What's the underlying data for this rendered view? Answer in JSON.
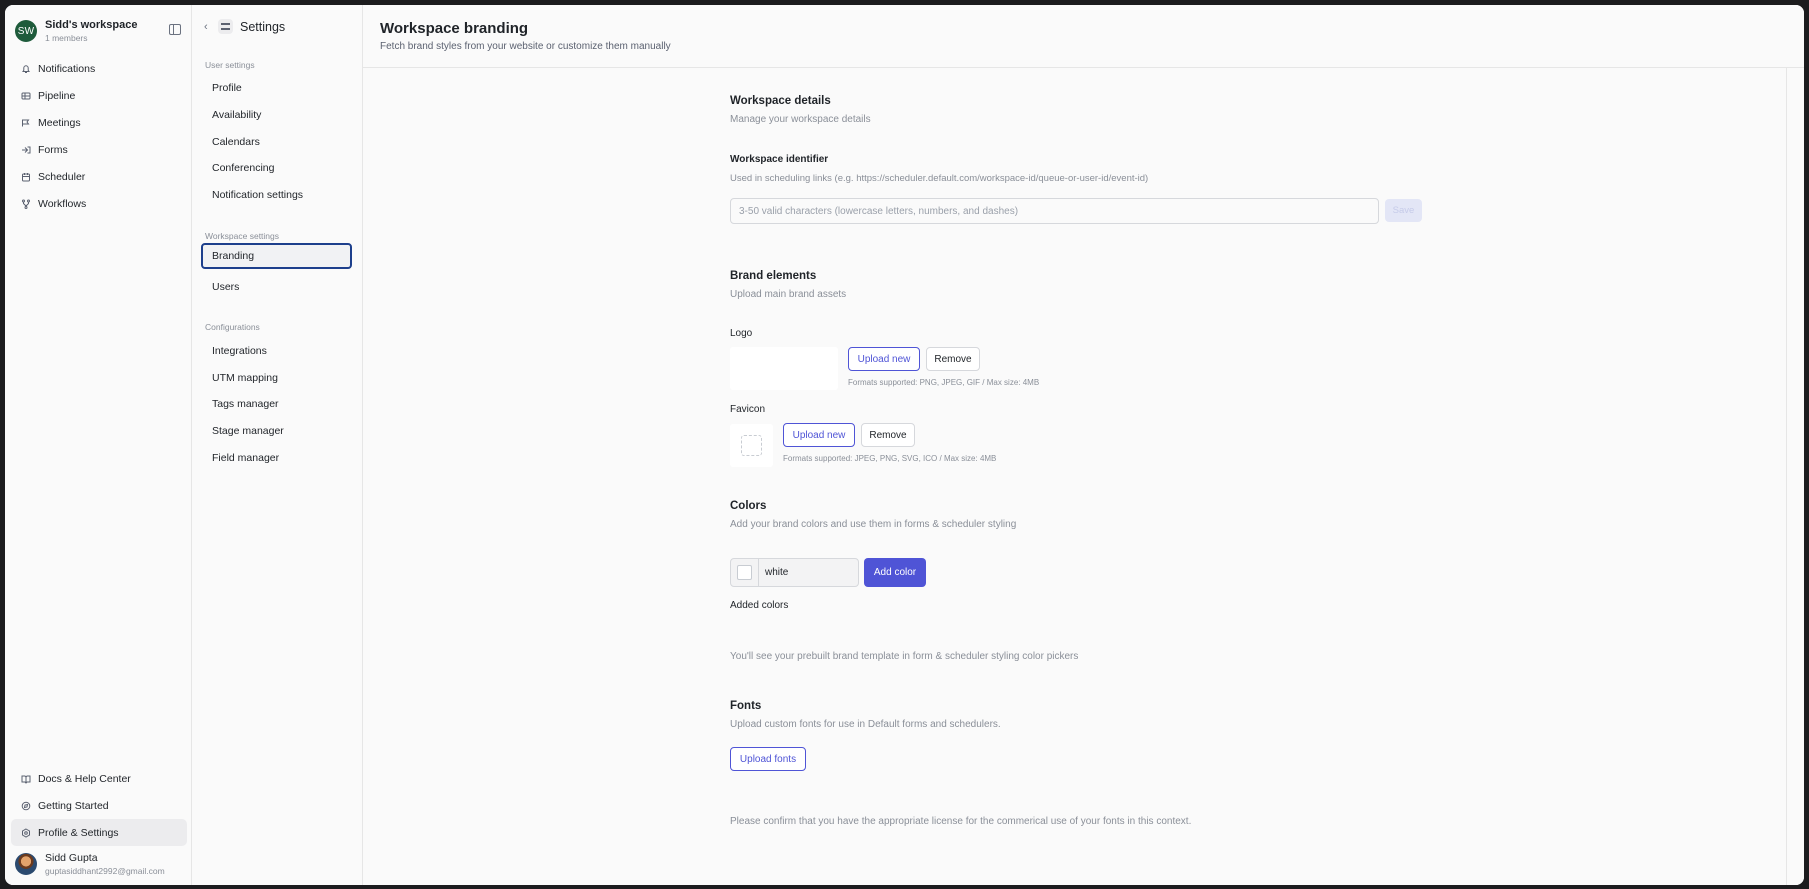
{
  "workspace": {
    "initials": "SW",
    "name": "Sidd's workspace",
    "members": "1 members"
  },
  "nav": {
    "items": [
      {
        "label": "Notifications",
        "icon": "bell-icon"
      },
      {
        "label": "Pipeline",
        "icon": "pipeline-icon"
      },
      {
        "label": "Meetings",
        "icon": "meetings-icon"
      },
      {
        "label": "Forms",
        "icon": "forms-icon"
      },
      {
        "label": "Scheduler",
        "icon": "calendar-icon"
      },
      {
        "label": "Workflows",
        "icon": "workflow-icon"
      }
    ],
    "bottom": [
      {
        "label": "Docs & Help Center",
        "icon": "book-icon"
      },
      {
        "label": "Getting Started",
        "icon": "rocket-icon"
      },
      {
        "label": "Profile & Settings",
        "icon": "hexagon-icon"
      }
    ]
  },
  "user": {
    "name": "Sidd Gupta",
    "email": "guptasiddhant2992@gmail.com"
  },
  "settings_nav": {
    "title": "Settings",
    "user_label": "User settings",
    "user_items": [
      "Profile",
      "Availability",
      "Calendars",
      "Conferencing",
      "Notification settings"
    ],
    "workspace_label": "Workspace settings",
    "workspace_items": [
      "Branding",
      "Users"
    ],
    "config_label": "Configurations",
    "config_items": [
      "Integrations",
      "UTM mapping",
      "Tags manager",
      "Stage manager",
      "Field manager"
    ]
  },
  "page": {
    "title": "Workspace branding",
    "subtitle": "Fetch brand styles from your website or customize them manually"
  },
  "details": {
    "title": "Workspace details",
    "subtitle": "Manage your workspace details",
    "identifier_label": "Workspace identifier",
    "identifier_hint": "Used in scheduling links (e.g. https://scheduler.default.com/workspace-id/queue-or-user-id/event-id)",
    "identifier_placeholder": "3-50 valid characters (lowercase letters, numbers, and dashes)",
    "save_label": "Save"
  },
  "brand": {
    "title": "Brand elements",
    "subtitle": "Upload main brand assets",
    "logo_label": "Logo",
    "logo_upload": "Upload new",
    "logo_remove": "Remove",
    "logo_formats": "Formats supported: PNG, JPEG, GIF / Max size: 4MB",
    "favicon_label": "Favicon",
    "favicon_upload": "Upload new",
    "favicon_remove": "Remove",
    "favicon_formats": "Formats supported: JPEG, PNG, SVG, ICO / Max size: 4MB"
  },
  "colors": {
    "title": "Colors",
    "subtitle": "Add your brand colors and use them in forms & scheduler styling",
    "color_value": "white",
    "add_label": "Add color",
    "added_label": "Added colors",
    "note": "You'll see your prebuilt brand template in form & scheduler styling color pickers"
  },
  "fonts": {
    "title": "Fonts",
    "subtitle": "Upload custom fonts for use in Default forms and schedulers.",
    "upload_label": "Upload fonts",
    "license_note": "Please confirm that you have the appropriate license for the commerical use of your fonts in this context."
  },
  "colors_palette": {
    "accent": "#4f54d6",
    "active_border": "#1d3f8c",
    "avatar_bg": "#1e5b3b"
  }
}
